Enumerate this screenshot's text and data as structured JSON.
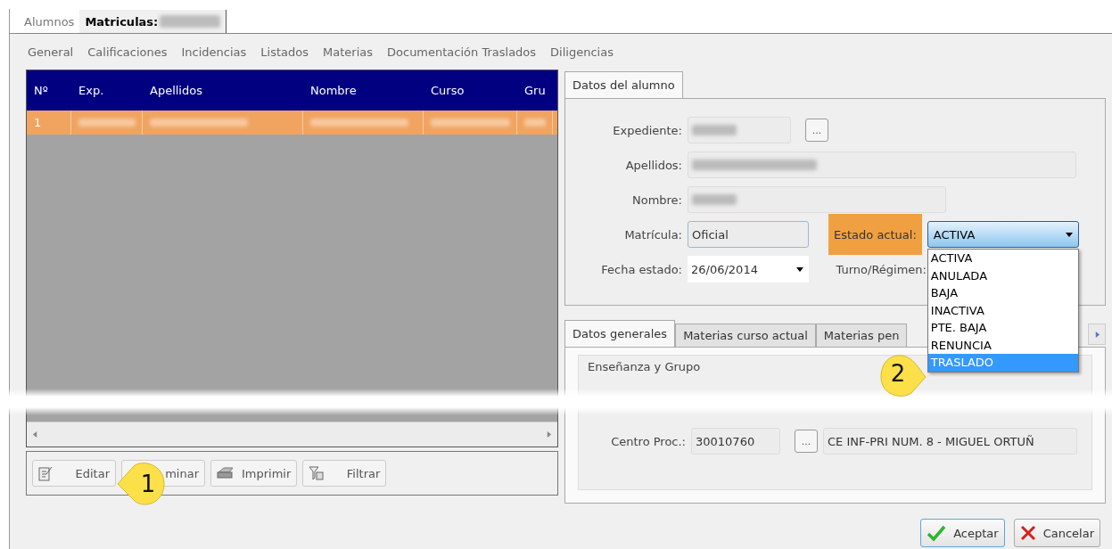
{
  "top_tabs": [
    {
      "label": "Alumnos",
      "selected": false
    },
    {
      "label": "Matriculas:",
      "selected": true
    }
  ],
  "menu": [
    "General",
    "Calificaciones",
    "Incidencias",
    "Listados",
    "Materias",
    "Documentación Traslados",
    "Diligencias"
  ],
  "grid": {
    "columns": [
      "Nº",
      "Exp.",
      "Apellidos",
      "Nombre",
      "Curso",
      "Gru"
    ],
    "rows": [
      {
        "number": "1",
        "selected": true
      }
    ]
  },
  "left_buttons": [
    {
      "label": "Editar",
      "kind": "edit"
    },
    {
      "label": "minar",
      "kind": "plain"
    },
    {
      "label": "Imprimir",
      "kind": "print"
    },
    {
      "label": "Filtrar",
      "kind": "filter"
    }
  ],
  "student_tab": {
    "label": "Datos del alumno",
    "selected": true
  },
  "form": {
    "expediente": {
      "label": "Expediente:",
      "button": "..."
    },
    "apellidos": {
      "label": "Apellidos:"
    },
    "nombre": {
      "label": "Nombre:"
    },
    "matricula": {
      "label": "Matrícula:",
      "value": "Oficial"
    },
    "estado": {
      "label": "Estado actual:",
      "value": "ACTIVA",
      "highlighted": true,
      "expanded": true
    },
    "fecha": {
      "label": "Fecha estado:",
      "value": "26/06/2014"
    },
    "turno": {
      "label": "Turno/Régimen:"
    }
  },
  "estado_options": [
    {
      "label": "ACTIVA",
      "selected": false
    },
    {
      "label": "ANULADA",
      "selected": false
    },
    {
      "label": "BAJA",
      "selected": false
    },
    {
      "label": "INACTIVA",
      "selected": false
    },
    {
      "label": "PTE. BAJA",
      "selected": false
    },
    {
      "label": "RENUNCIA",
      "selected": false
    },
    {
      "label": "TRASLADO",
      "selected": true
    }
  ],
  "lower_tabs": [
    {
      "label": "Datos generales",
      "selected": true
    },
    {
      "label": "Materias curso actual",
      "selected": false
    },
    {
      "label": "Materias pen",
      "selected": false
    }
  ],
  "group": {
    "title": "Enseñanza y Grupo",
    "centro_label": "Centro Proc.:",
    "centro_code": "30010760",
    "centro_button": "...",
    "centro_name": "CE INF-PRI NUM. 8 - MIGUEL ORTUÑ"
  },
  "callouts": [
    {
      "label": "1"
    },
    {
      "label": "2"
    }
  ],
  "footer_buttons": [
    {
      "label": "Aceptar",
      "kind": "ok"
    },
    {
      "label": "Cancelar",
      "kind": "cancel"
    }
  ]
}
